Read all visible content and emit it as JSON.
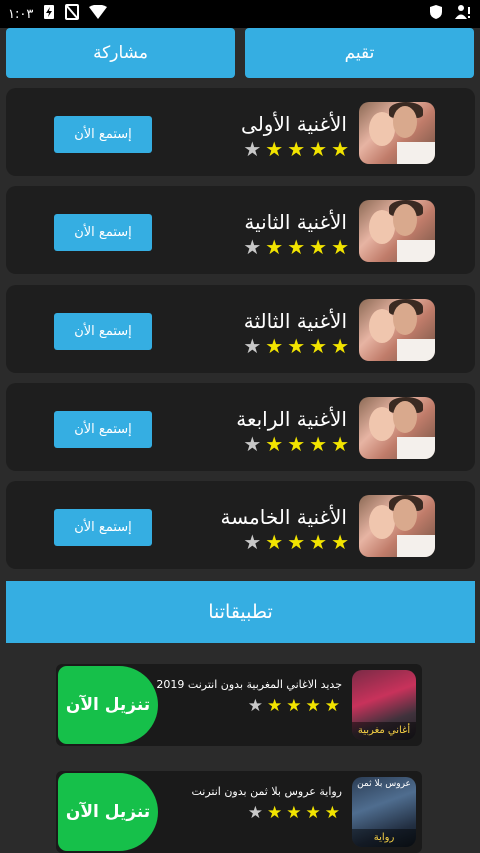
{
  "status_bar": {
    "time": "١:٠٣"
  },
  "top_buttons": {
    "rate_label": "تقيم",
    "share_label": "مشاركة"
  },
  "songs": [
    {
      "title": "الأغنية الأولى",
      "rating": 4,
      "max_rating": 5,
      "button": "إستمع الأن"
    },
    {
      "title": "الأغنية الثانية",
      "rating": 4,
      "max_rating": 5,
      "button": "إستمع الأن"
    },
    {
      "title": "الأغنية الثالثة",
      "rating": 4,
      "max_rating": 5,
      "button": "إستمع الأن"
    },
    {
      "title": "الأغنية الرابعة",
      "rating": 4,
      "max_rating": 5,
      "button": "إستمع الأن"
    },
    {
      "title": "الأغنية الخامسة",
      "rating": 4,
      "max_rating": 5,
      "button": "إستمع الأن"
    }
  ],
  "apps_section": {
    "title": "تطبيقاتنا"
  },
  "apps": [
    {
      "title": "جديد الاغاني المغربية بدون انترنت 2019",
      "rating": 4,
      "max_rating": 5,
      "button": "تنزيل الآن",
      "icon_caption": "أغاني مغربية",
      "icon_top": ""
    },
    {
      "title": "رواية عروس بلا ثمن بدون انترنت",
      "rating": 4,
      "max_rating": 5,
      "button": "تنزيل الآن",
      "icon_caption": "رواية",
      "icon_top": "عروس بلا ثمن"
    }
  ],
  "colors": {
    "accent": "#35aee2",
    "background": "#2b2b2b",
    "card": "#1e1e1e",
    "download": "#16c04a",
    "star_on": "#f2e400",
    "star_off": "#c8c8c8"
  }
}
